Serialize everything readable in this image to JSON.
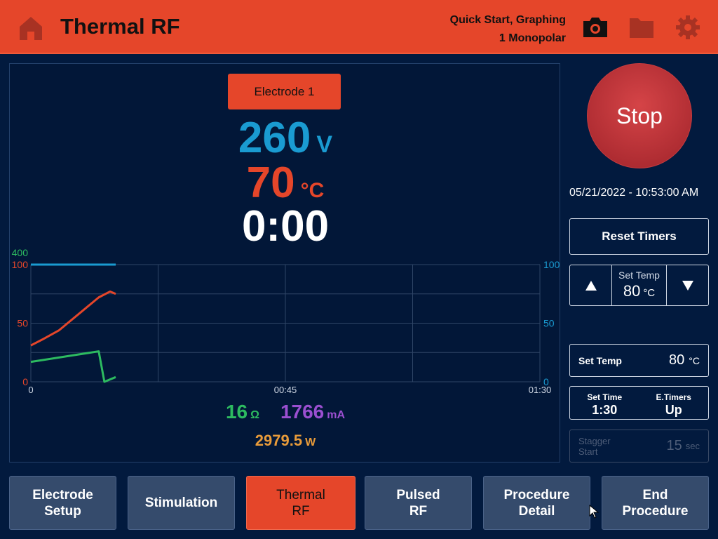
{
  "header": {
    "title": "Thermal RF",
    "mode_line1": "Quick Start, Graphing",
    "mode_line2": "1 Monopolar",
    "icons": [
      "home-icon",
      "camera-icon",
      "folder-icon",
      "gear-icon"
    ],
    "bg_color": "#e5462a"
  },
  "readout": {
    "electrode_label": "Electrode 1",
    "voltage": "260",
    "voltage_unit": "V",
    "temperature": "70",
    "temperature_unit": "°C",
    "elapsed": "0:00",
    "impedance": "16",
    "impedance_unit": "Ω",
    "current": "1766",
    "current_unit": "mA",
    "power": "2979.5",
    "power_unit": "W"
  },
  "chart_data": {
    "type": "line",
    "x_ticks": [
      "0",
      "00:45",
      "01:30"
    ],
    "xlim": [
      0,
      90
    ],
    "left_axis": {
      "ticks": [
        "0",
        "50",
        "100"
      ],
      "top_label": "400",
      "ylim": [
        0,
        100
      ],
      "color": "#e5462a"
    },
    "right_axis": {
      "ticks": [
        "0",
        "50",
        "100"
      ],
      "ylim": [
        0,
        100
      ],
      "color": "#1a9bd1"
    },
    "grid": true,
    "series": [
      {
        "color": "#e5462a",
        "x": [
          0,
          2,
          5,
          9,
          12,
          14,
          15
        ],
        "y": [
          31,
          36,
          44,
          60,
          72,
          77,
          75
        ]
      },
      {
        "color": "#2dbb60",
        "x": [
          0,
          12,
          13,
          15
        ],
        "y": [
          17,
          26,
          0,
          4
        ]
      },
      {
        "color": "#1a9bd1",
        "x": [
          0,
          15
        ],
        "y": [
          100,
          100
        ]
      }
    ]
  },
  "controls": {
    "stop_label": "Stop",
    "datetime": "05/21/2022 - 10:53:00 AM",
    "reset_label": "Reset Timers",
    "stepper_label": "Set Temp",
    "stepper_value": "80",
    "stepper_unit": "°C",
    "settemp_label": "Set Temp",
    "settemp_value": "80",
    "settemp_unit": "°C",
    "settime_label": "Set Time",
    "settime_value": "1:30",
    "etimers_label": "E.Timers",
    "etimers_value": "Up",
    "stagger_label": "Stagger\nStart",
    "stagger_value": "15",
    "stagger_unit": "sec"
  },
  "tabs": [
    {
      "label": "Electrode\nSetup",
      "active": false
    },
    {
      "label": "Stimulation",
      "active": false
    },
    {
      "label": "Thermal\nRF",
      "active": true
    },
    {
      "label": "Pulsed\nRF",
      "active": false
    },
    {
      "label": "Procedure\nDetail",
      "active": false
    },
    {
      "label": "End\nProcedure",
      "active": false
    }
  ]
}
